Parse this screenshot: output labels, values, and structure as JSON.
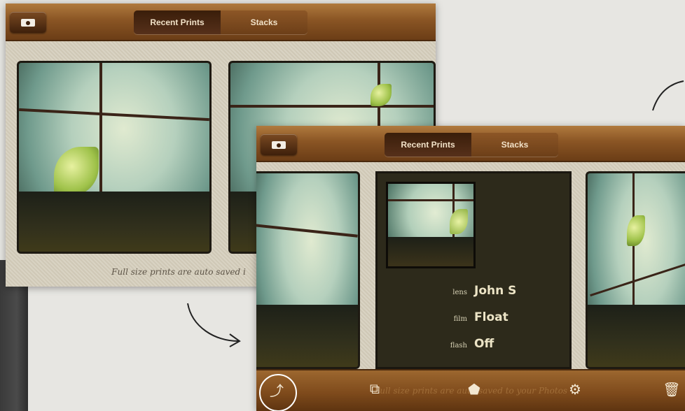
{
  "back": {
    "tabs": [
      {
        "label": "Recent Prints",
        "active": true
      },
      {
        "label": "Stacks",
        "active": false
      }
    ],
    "caption": "Full size prints are auto saved i"
  },
  "front": {
    "tabs": [
      {
        "label": "Recent Prints",
        "active": true
      },
      {
        "label": "Stacks",
        "active": false
      }
    ],
    "info": [
      {
        "label": "lens",
        "value": "John S"
      },
      {
        "label": "film",
        "value": "Float"
      },
      {
        "label": "flash",
        "value": "Off"
      }
    ],
    "bottom_caption": "Full size prints are auto saved to your Photos",
    "toolbar_icons": [
      "share-icon",
      "stack-add-icon",
      "shield-icon",
      "camera-settings-icon",
      "trash-icon"
    ]
  },
  "colors": {
    "wood_light": "#b07a3e",
    "wood_dark": "#6b3d16",
    "linen": "#d5cfbf",
    "card_dark": "#2d2a1b"
  }
}
